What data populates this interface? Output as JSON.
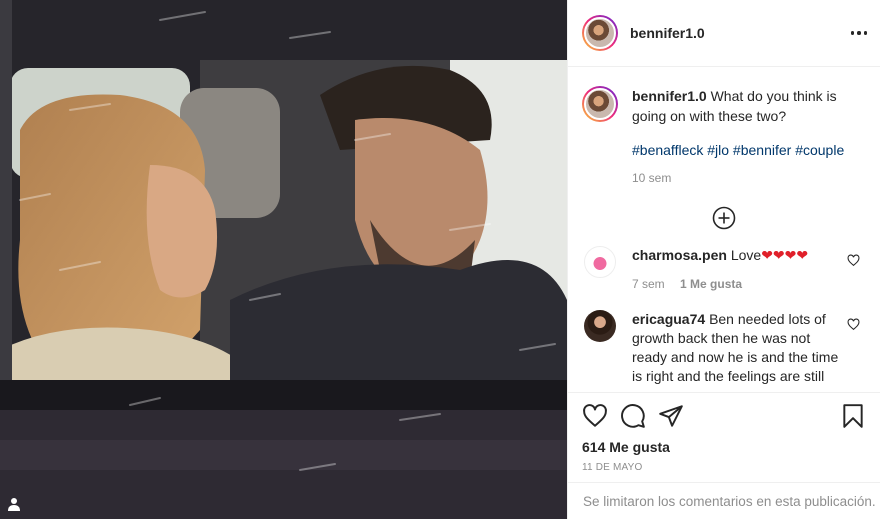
{
  "post": {
    "username": "bennifer1.0",
    "more_icon": "more-options-icon",
    "caption_text": "What do you think is going on with these two?",
    "hashtags": "#benaffleck #jlo #bennifer #couple",
    "caption_time": "10 sem",
    "load_more_icon": "plus-circle-icon"
  },
  "comments": [
    {
      "username": "charmosa.pen",
      "text": "Love",
      "hearts": "❤❤❤❤",
      "time": "7 sem",
      "likes": "1 Me gusta"
    },
    {
      "username": "ericagua74",
      "text": "Ben needed lots of growth back then he was not ready and now he is and the time is right and the feelings are still"
    }
  ],
  "actions": {
    "like_icon": "heart-icon",
    "comment_icon": "comment-icon",
    "share_icon": "share-icon",
    "save_icon": "bookmark-icon"
  },
  "likes_count": "614 Me gusta",
  "date": "11 DE MAYO",
  "comments_limited": "Se limitaron los comentarios en esta publicación.",
  "colors": {
    "link": "#00376b",
    "muted": "#8e8e8e",
    "text": "#262626",
    "heart": "#e0202a"
  }
}
